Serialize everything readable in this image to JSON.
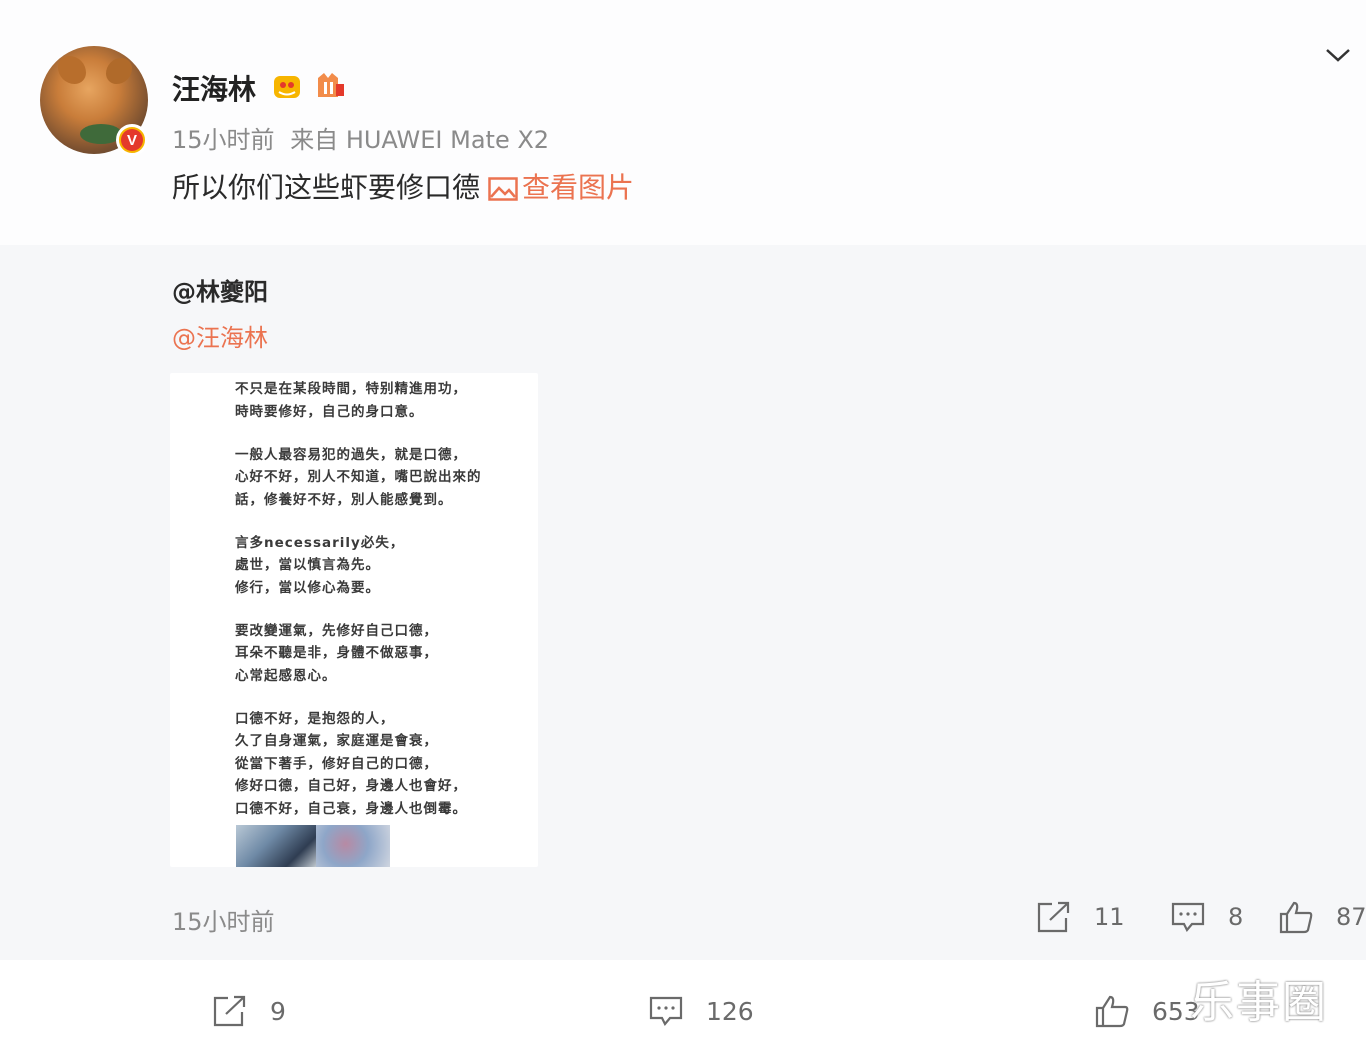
{
  "post": {
    "username": "汪海林",
    "time": "15小时前",
    "source": "来自 HUAWEI Mate X2",
    "text": "所以你们这些虾要修口德",
    "view_picture_label": "查看图片"
  },
  "repost": {
    "author": "@林夔阳",
    "mention": "@汪海林",
    "image_text_lines": [
      "不只是在某段時間，特别精進用功，",
      "時時要修好，自己的身口意。",
      "一般人最容易犯的過失，就是口德，",
      "心好不好，別人不知道，嘴巴說出來的",
      "話，修養好不好，別人能感覺到。",
      "言多necessarily必失，",
      "處世，當以慎言為先。",
      "修行，當以修心為要。",
      "要改變運氣，先修好自己口德，",
      "耳朵不聽是非，身體不做惡事，",
      "心常起感恩心。",
      "口德不好，是抱怨的人，",
      "久了自身運氣，家庭運是會衰，",
      "從當下著手，修好自己的口德，",
      "修好口德，自己好，身邊人也會好，",
      "口德不好，自己衰，身邊人也倒霉。"
    ],
    "time": "15小时前",
    "stats": {
      "repost": "11",
      "comment": "8",
      "like": "87"
    }
  },
  "footer": {
    "repost": "9",
    "comment": "126",
    "like": "653"
  },
  "watermark": "乐事圈"
}
